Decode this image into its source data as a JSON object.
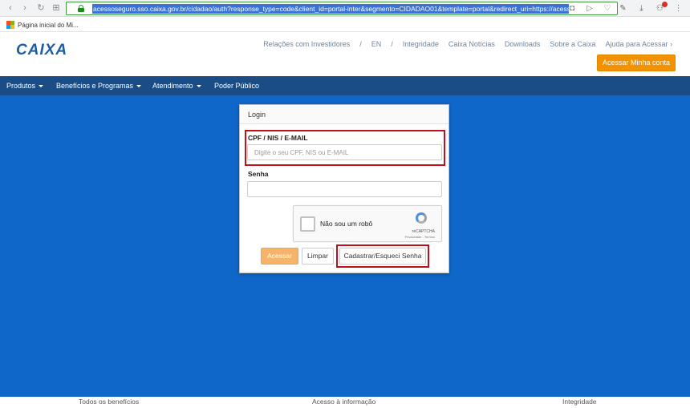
{
  "browser": {
    "url": "acessoseguro.sso.caixa.gov.br/cidadao/auth?response_type=code&client_id=portal-inter&segmento=CIDADAO01&template=portal&redirect_uri=https://acessoseguro",
    "nav_icons": [
      "back-icon",
      "forward-icon",
      "reload-icon",
      "apps-icon"
    ],
    "bookmark_label": "Página inicial do Mi..."
  },
  "header": {
    "logo_text": "CAIXA",
    "top_links": [
      "Relações com Investidores",
      "/",
      "EN",
      "/",
      "Integridade",
      "Caixa Notícias",
      "Downloads",
      "Sobre a Caixa",
      "Ajuda para Acessar ›"
    ],
    "access_button": "Acessar Minha conta"
  },
  "nav": {
    "items": [
      "Produtos",
      "Benefícios e Programas",
      "Atendimento",
      "Poder Público"
    ]
  },
  "login": {
    "title": "Login",
    "cpf_label": "CPF / NIS / E-MAIL",
    "cpf_placeholder": "Digite o seu CPF, NIS ou E-MAIL",
    "password_label": "Senha",
    "password_value": "",
    "recaptcha_label": "Não sou um robô",
    "recaptcha_brand": "reCAPTCHA",
    "recaptcha_links": "Privacidade - Termos",
    "enter_button": "Acessar",
    "clear_button": "Limpar",
    "register_button": "Cadastrar/Esqueci Senha"
  },
  "footer": {
    "links": [
      "Todos os benefícios",
      "Acesso à informação",
      "Integridade"
    ]
  },
  "colors": {
    "brand_blue": "#1a5ea6",
    "nav_blue": "#1a4d86",
    "background_blue": "#0f67c9",
    "accent_orange": "#f39200",
    "highlight_red": "#c0101a"
  }
}
